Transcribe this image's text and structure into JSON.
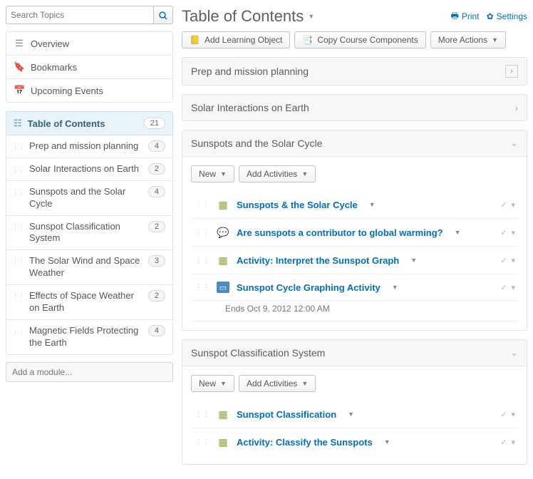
{
  "search": {
    "placeholder": "Search Topics"
  },
  "nav": {
    "overview": "Overview",
    "bookmarks": "Bookmarks",
    "upcoming": "Upcoming Events"
  },
  "toc": {
    "head": "Table of Contents",
    "total": "21",
    "items": [
      {
        "label": "Prep and mission planning",
        "count": "4"
      },
      {
        "label": "Solar Interactions on Earth",
        "count": "2"
      },
      {
        "label": "Sunspots and the Solar Cycle",
        "count": "4"
      },
      {
        "label": "Sunspot Classification System",
        "count": "2"
      },
      {
        "label": "The Solar Wind and Space Weather",
        "count": "3"
      },
      {
        "label": "Effects of Space Weather on Earth",
        "count": "2"
      },
      {
        "label": "Magnetic Fields Protecting the Earth",
        "count": "4"
      }
    ]
  },
  "add_module_placeholder": "Add a module...",
  "header": {
    "title": "Table of Contents",
    "print": "Print",
    "settings": "Settings"
  },
  "toolbar": {
    "add_lo": "Add Learning Object",
    "copy": "Copy Course Components",
    "more": "More Actions"
  },
  "modules": [
    {
      "title": "Prep and mission planning",
      "collapsed": true,
      "boxed_chevron": true
    },
    {
      "title": "Solar Interactions on Earth",
      "collapsed": true
    },
    {
      "title": "Sunspots and the Solar Cycle",
      "collapsed": false,
      "sub_new": "New",
      "sub_add": "Add Activities",
      "items": [
        {
          "kind": "quiz",
          "title": "Sunspots & the Solar Cycle"
        },
        {
          "kind": "discuss",
          "title": "Are sunspots a contributor to global warming?"
        },
        {
          "kind": "activity",
          "title": "Activity: Interpret the Sunspot Graph"
        },
        {
          "kind": "dropbox",
          "title": "Sunspot Cycle Graphing Activity",
          "due": "Ends Oct 9, 2012 12:00 AM"
        }
      ]
    },
    {
      "title": "Sunspot Classification System",
      "collapsed": false,
      "sub_new": "New",
      "sub_add": "Add Activities",
      "items": [
        {
          "kind": "quiz",
          "title": "Sunspot Classification"
        },
        {
          "kind": "activity",
          "title": "Activity: Classify the Sunspots"
        }
      ]
    }
  ]
}
